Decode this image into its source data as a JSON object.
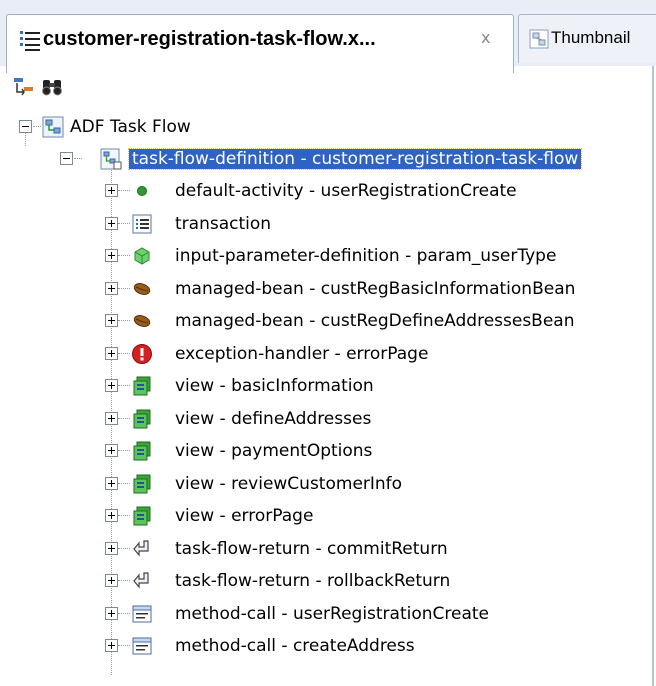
{
  "tabs": {
    "active": {
      "title": "customer-registration-task-flow.x...",
      "close": "x"
    },
    "inactive": {
      "title": "Thumbnail"
    }
  },
  "toolbar": {
    "buttons": [
      "tree-sort-icon",
      "binoculars-icon"
    ]
  },
  "tree": {
    "root": {
      "label": "ADF Task Flow",
      "icon": "task-flow-icon"
    },
    "definition": {
      "label": "task-flow-definition - customer-registration-task-flow",
      "icon": "task-flow-definition-icon",
      "selected": true
    },
    "children": [
      {
        "label": "default-activity - userRegistrationCreate",
        "icon": "green-dot-icon"
      },
      {
        "label": "transaction",
        "icon": "list-icon"
      },
      {
        "label": "input-parameter-definition - param_userType",
        "icon": "input-parameter-icon"
      },
      {
        "label": "managed-bean - custRegBasicInformationBean",
        "icon": "bean-icon"
      },
      {
        "label": "managed-bean - custRegDefineAddressesBean",
        "icon": "bean-icon"
      },
      {
        "label": "exception-handler - errorPage",
        "icon": "exclamation-icon"
      },
      {
        "label": "view - basicInformation",
        "icon": "view-icon"
      },
      {
        "label": "view - defineAddresses",
        "icon": "view-icon"
      },
      {
        "label": "view - paymentOptions",
        "icon": "view-icon"
      },
      {
        "label": "view - reviewCustomerInfo",
        "icon": "view-icon"
      },
      {
        "label": "view - errorPage",
        "icon": "view-icon"
      },
      {
        "label": "task-flow-return - commitReturn",
        "icon": "return-arrow-icon"
      },
      {
        "label": "task-flow-return - rollbackReturn",
        "icon": "return-arrow-icon"
      },
      {
        "label": "method-call - userRegistrationCreate",
        "icon": "method-call-icon"
      },
      {
        "label": "method-call - createAddress",
        "icon": "method-call-icon"
      }
    ]
  },
  "colors": {
    "selection": "#2f63c3",
    "tab_strip": "#e9eef6"
  }
}
